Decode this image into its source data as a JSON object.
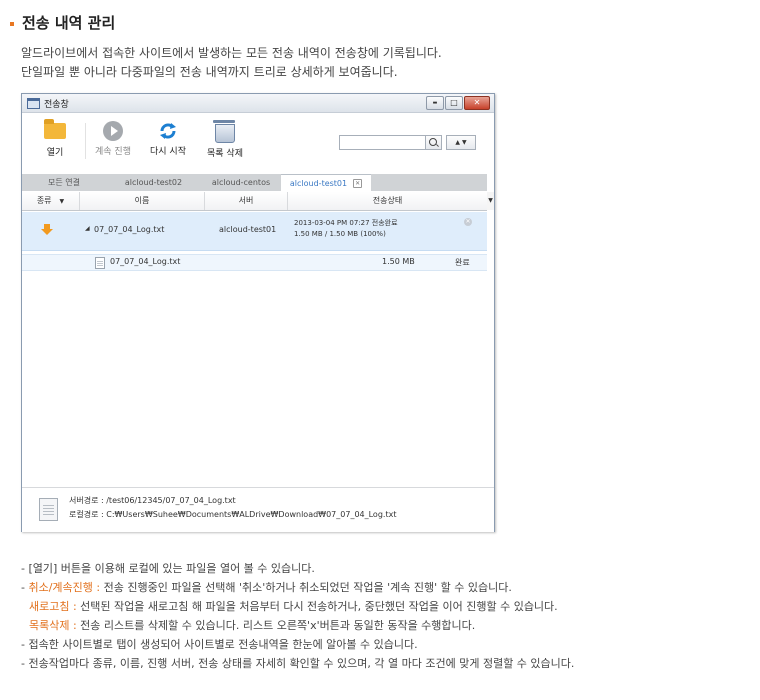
{
  "page": {
    "heading": "전송 내역 관리",
    "intro": [
      "알드라이브에서 접속한 사이트에서 발생하는 모든 전송 내역이 전송창에 기록됩니다.",
      "단일파일 뿐 아니라 다중파일의 전송 내역까지 트리로 상세하게 보여줍니다."
    ]
  },
  "window": {
    "title": "전송창",
    "controls": {
      "minimize": "▬",
      "maximize": "□",
      "close": "✕"
    }
  },
  "toolbar": {
    "open": {
      "label": "열기",
      "icon": "folder-icon"
    },
    "resume": {
      "label": "계속 진행",
      "icon": "play-icon"
    },
    "restart": {
      "label": "다시 시작",
      "icon": "refresh-icon"
    },
    "delete_list": {
      "label": "목록 삭제",
      "icon": "trash-icon"
    },
    "search_value": "",
    "updown_glyph": "▲ ▼"
  },
  "tabs": [
    {
      "label": "모든 연결",
      "active": false
    },
    {
      "label": "alcloud-test02",
      "active": false
    },
    {
      "label": "alcloud-centos",
      "active": false
    },
    {
      "label": "alcloud-test01",
      "active": true,
      "close_glyph": "✕"
    }
  ],
  "columns": {
    "type": "종류",
    "name": "이름",
    "server": "서버",
    "status": "전송상태"
  },
  "rows": [
    {
      "expander": "◢",
      "name": "07_07_04_Log.txt",
      "server": "alcloud-test01",
      "status_line1": "2013-03-04 PM 07:27 전송완료",
      "status_line2": "1.50 MB / 1.50 MB (100%)",
      "icon": "download-arrow-icon",
      "close_glyph": "✕"
    }
  ],
  "children": [
    {
      "name": "07_07_04_Log.txt",
      "size": "1.50 MB",
      "status": "완료",
      "icon": "file-icon"
    }
  ],
  "statusbar": {
    "server_path_label": "서버경로 :",
    "server_path": "/test06/12345/07_07_04_Log.txt",
    "local_path_label": "로컬경로 :",
    "local_path": "C:₩Users₩Suhee₩Documents₩ALDrive₩Download₩07_07_04_Log.txt"
  },
  "notes": {
    "line1": "- [열기] 버튼을 이용해 로컬에 있는 파일을 열어 볼 수 있습니다.",
    "line2_prefix": "- ",
    "line2_highlight": "취소/계속진행 :",
    "line2_text": " 전송 진행중인 파일을 선택해 '취소'하거나 취소되었던 작업을 '계속 진행' 할 수 있습니다.",
    "line3_highlight": "새로고침 :",
    "line3_text": " 선택된 작업을 새로고침 해 파일을 처음부터 다시 전송하거나, 중단했던 작업을 이어 진행할 수 있습니다.",
    "line4_highlight": "목록삭제 :",
    "line4_text": " 전송 리스트를 삭제할 수 있습니다. 리스트 오른쪽'x'버튼과 동일한 동작을 수행합니다.",
    "line5": "- 접속한 사이트별로 탭이 생성되어 사이트별로 전송내역을 한눈에 알아볼 수 있습니다.",
    "line6": "- 전송작업마다 종류, 이름, 진행 서버, 전송 상태를 자세히 확인할 수 있으며, 각 열 마다 조건에 맞게 정렬할 수 있습니다."
  },
  "colors": {
    "accent": "#e2711d",
    "tab_active": "#3b79c4",
    "row_selected": "#dfedfb"
  }
}
